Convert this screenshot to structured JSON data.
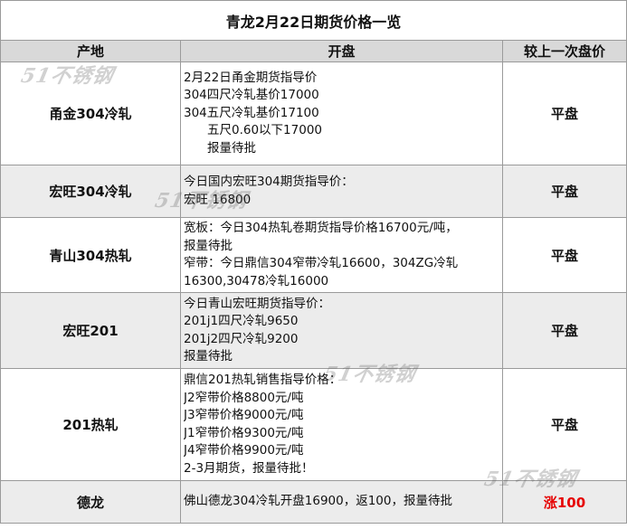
{
  "title": "青龙2月22日期货价格一览",
  "headers": {
    "region": "产地",
    "open": "开盘",
    "change": "较上一次盘价"
  },
  "rows": [
    {
      "region": "甬金304冷轧",
      "lines": [
        {
          "text": "2月22日甬金期货指导价",
          "indent": false
        },
        {
          "text": "304四尺冷轧基价17000",
          "indent": false
        },
        {
          "text": "304五尺冷轧基价17100",
          "indent": false
        },
        {
          "text": "五尺0.60以下17000",
          "indent": true
        },
        {
          "text": "报量待批",
          "indent": true
        }
      ],
      "change": "平盘",
      "up": false
    },
    {
      "region": "宏旺304冷轧",
      "lines": [
        {
          "text": "今日国内宏旺304期货指导价：",
          "indent": false
        },
        {
          "text": "宏旺 16800",
          "indent": false
        }
      ],
      "change": "平盘",
      "up": false
    },
    {
      "region": "青山304热轧",
      "lines": [
        {
          "text": "宽板：今日304热轧卷期货指导价格16700元/吨，",
          "indent": false
        },
        {
          "text": "报量待批",
          "indent": false
        },
        {
          "text": "窄带：今日鼎信304窄带冷轧16600，304ZG冷轧",
          "indent": false
        },
        {
          "text": "16300,30478冷轧16000",
          "indent": false
        }
      ],
      "change": "平盘",
      "up": false
    },
    {
      "region": "宏旺201",
      "lines": [
        {
          "text": "今日青山宏旺期货指导价：",
          "indent": false
        },
        {
          "text": "201j1四尺冷轧9650",
          "indent": false
        },
        {
          "text": "201j2四尺冷轧9200",
          "indent": false
        },
        {
          "text": "报量待批",
          "indent": false
        }
      ],
      "change": "平盘",
      "up": false
    },
    {
      "region": "201热轧",
      "lines": [
        {
          "text": "鼎信201热轧销售指导价格：",
          "indent": false
        },
        {
          "text": "J2窄带价格8800元/吨",
          "indent": false
        },
        {
          "text": "J3窄带价格9000元/吨",
          "indent": false
        },
        {
          "text": "J1窄带价格9300元/吨",
          "indent": false
        },
        {
          "text": "J4窄带价格9900元/吨",
          "indent": false
        },
        {
          "text": "2-3月期货，报量待批！",
          "indent": false
        }
      ],
      "change": "平盘",
      "up": false
    },
    {
      "region": "德龙",
      "lines": [
        {
          "text": "佛山德龙304冷轧开盘16900，返100，报量待批",
          "indent": false
        }
      ],
      "change": "涨100",
      "up": true
    }
  ],
  "watermark": "51不锈钢"
}
